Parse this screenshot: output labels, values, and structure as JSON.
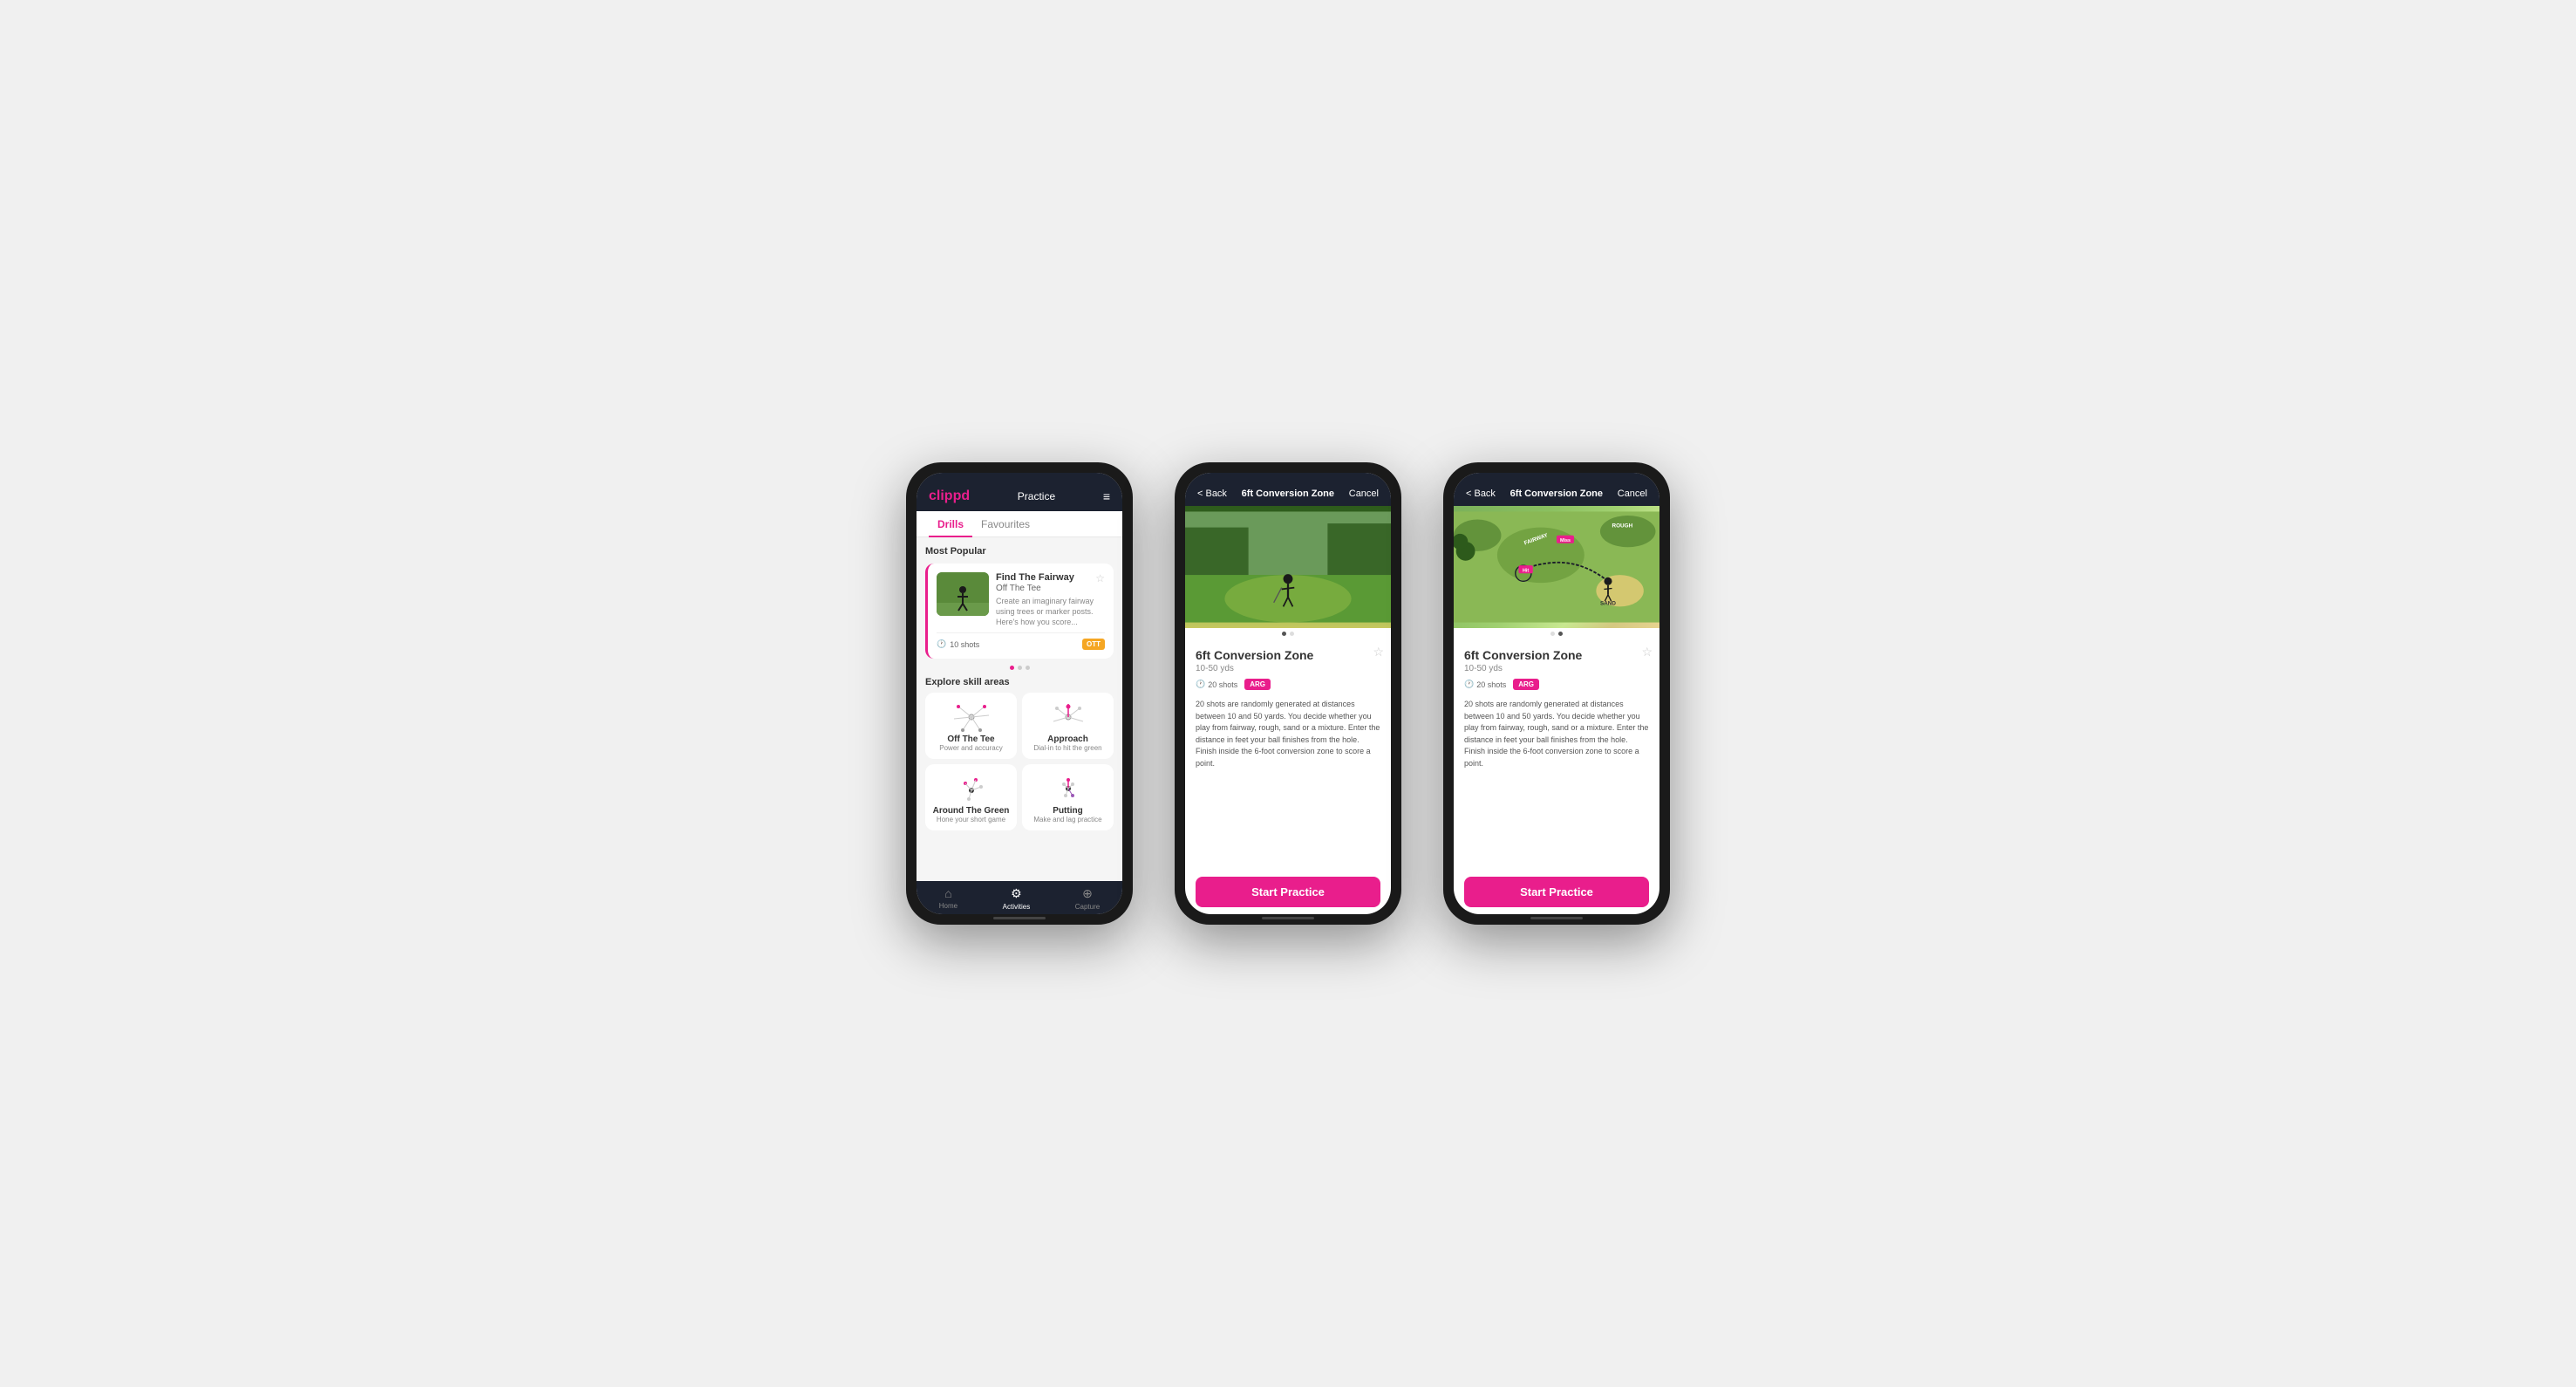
{
  "phones": [
    {
      "id": "phone1",
      "type": "list",
      "header": {
        "logo": "clippd",
        "title": "Practice",
        "menu_icon": "≡"
      },
      "tabs": [
        {
          "label": "Drills",
          "active": true
        },
        {
          "label": "Favourites",
          "active": false
        }
      ],
      "most_popular": {
        "section_title": "Most Popular",
        "card": {
          "title": "Find The Fairway",
          "subtitle": "Off The Tee",
          "description": "Create an imaginary fairway using trees or marker posts. Here's how you score...",
          "shots": "10 shots",
          "tag": "OTT"
        },
        "dots": [
          true,
          false,
          false
        ]
      },
      "explore": {
        "section_title": "Explore skill areas",
        "skills": [
          {
            "name": "Off The Tee",
            "desc": "Power and accuracy"
          },
          {
            "name": "Approach",
            "desc": "Dial-in to hit the green"
          },
          {
            "name": "Around The Green",
            "desc": "Hone your short game"
          },
          {
            "name": "Putting",
            "desc": "Make and lag practice"
          }
        ]
      },
      "bottom_nav": [
        {
          "label": "Home",
          "icon": "⌂",
          "active": false
        },
        {
          "label": "Activities",
          "icon": "⚙",
          "active": true
        },
        {
          "label": "Capture",
          "icon": "+",
          "active": false
        }
      ]
    },
    {
      "id": "phone2",
      "type": "detail_photo",
      "header": {
        "back_label": "< Back",
        "title": "6ft Conversion Zone",
        "cancel_label": "Cancel"
      },
      "dots": [
        true,
        false
      ],
      "drill": {
        "title": "6ft Conversion Zone",
        "yardage": "10-50 yds",
        "shots": "20 shots",
        "tag": "ARG",
        "description": "20 shots are randomly generated at distances between 10 and 50 yards. You decide whether you play from fairway, rough, sand or a mixture. Enter the distance in feet your ball finishes from the hole. Finish inside the 6-foot conversion zone to score a point."
      },
      "start_button": "Start Practice"
    },
    {
      "id": "phone3",
      "type": "detail_map",
      "header": {
        "back_label": "< Back",
        "title": "6ft Conversion Zone",
        "cancel_label": "Cancel"
      },
      "dots": [
        false,
        true
      ],
      "drill": {
        "title": "6ft Conversion Zone",
        "yardage": "10-50 yds",
        "shots": "20 shots",
        "tag": "ARG",
        "description": "20 shots are randomly generated at distances between 10 and 50 yards. You decide whether you play from fairway, rough, sand or a mixture. Enter the distance in feet your ball finishes from the hole. Finish inside the 6-foot conversion zone to score a point."
      },
      "map_labels": {
        "fairway": "FAIRWAY",
        "rough": "ROUGH",
        "sand": "SAND",
        "hit": "Hit",
        "miss": "Miss"
      },
      "start_button": "Start Practice"
    }
  ]
}
